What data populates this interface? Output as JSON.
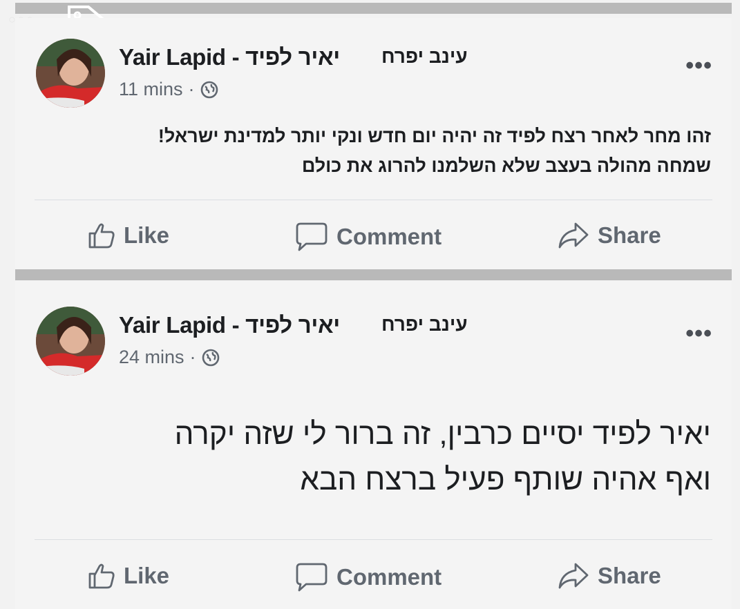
{
  "posts": [
    {
      "author": "Yair Lapid - יאיר לפיד",
      "page_name": "עינב יפרח",
      "time": "11 mins",
      "separator": "·",
      "more": "•••",
      "body_lines": [
        "זהו מחר לאחר רצח לפיד זה יהיה יום חדש ונקי יותר למדינת ישראל!",
        "שמחה מהולה בעצב שלא השלמנו להרוג את כולם"
      ],
      "actions": {
        "like": "Like",
        "comment": "Comment",
        "share": "Share"
      }
    },
    {
      "author": "Yair Lapid - יאיר לפיד",
      "page_name": "עינב יפרח",
      "time": "24 mins",
      "separator": "·",
      "more": "•••",
      "body_lines": [
        "יאיר לפיד יסיים כרבין, זה ברור לי שזה יקרה",
        "ואף אהיה שותף פעיל ברצח הבא"
      ],
      "actions": {
        "like": "Like",
        "comment": "Comment",
        "share": "Share"
      }
    }
  ],
  "icons": [
    "like-icon",
    "comment-icon",
    "share-icon",
    "globe-icon",
    "more-icon"
  ],
  "colors": {
    "text": "#1c1e21",
    "secondary": "#606770",
    "divider": "#b9b9b9"
  }
}
